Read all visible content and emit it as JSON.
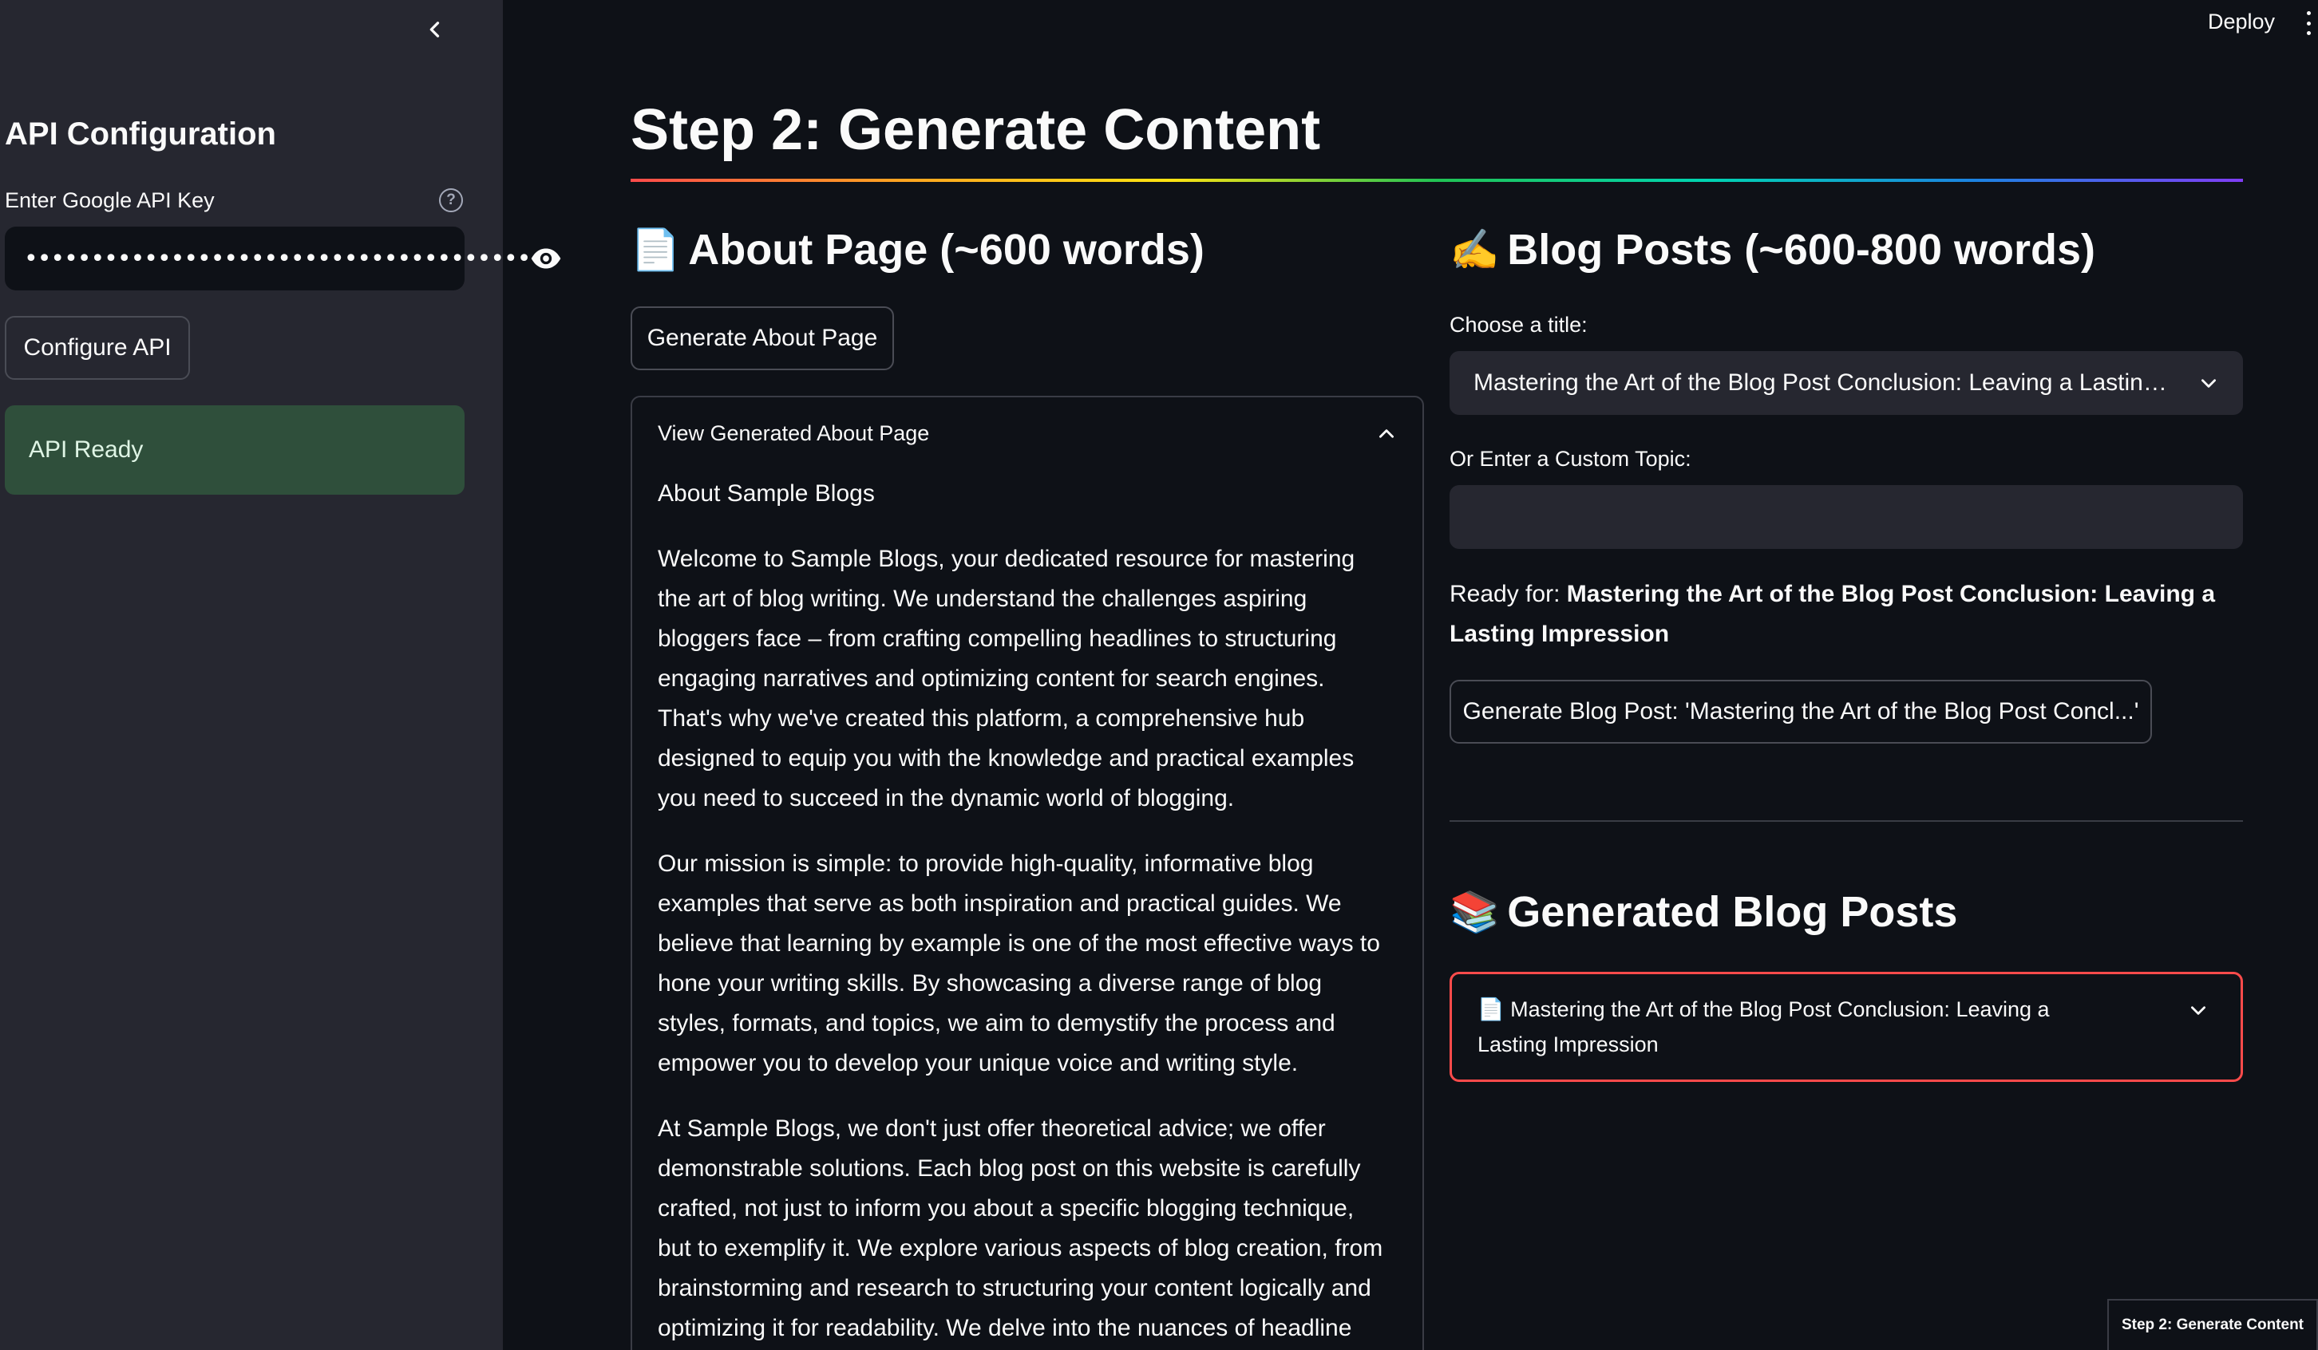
{
  "sidebar": {
    "title": "API Configuration",
    "api_key_label": "Enter Google API Key",
    "api_key_masked": "••••••••••••••••••••••••••••••••••••••",
    "help_glyph": "?",
    "configure_label": "Configure API",
    "status_text": "API Ready",
    "status_color": "#2f4f3b"
  },
  "topbar": {
    "deploy_label": "Deploy"
  },
  "main": {
    "title": "Step 2: Generate Content",
    "about": {
      "emoji": "📄",
      "heading": "About Page (~600 words)",
      "generate_label": "Generate About Page",
      "expander_label": "View Generated About Page",
      "subtitle": "About Sample Blogs",
      "paragraphs": [
        "Welcome to Sample Blogs, your dedicated resource for mastering the art of blog writing. We understand the challenges aspiring bloggers face – from crafting compelling headlines to structuring engaging narratives and optimizing content for search engines. That's why we've created this platform, a comprehensive hub designed to equip you with the knowledge and practical examples you need to succeed in the dynamic world of blogging.",
        "Our mission is simple: to provide high-quality, informative blog examples that serve as both inspiration and practical guides. We believe that learning by example is one of the most effective ways to hone your writing skills. By showcasing a diverse range of blog styles, formats, and topics, we aim to demystify the process and empower you to develop your unique voice and writing style.",
        "At Sample Blogs, we don't just offer theoretical advice; we offer demonstrable solutions. Each blog post on this website is carefully crafted, not just to inform you about a specific blogging technique, but to exemplify it. We explore various aspects of blog creation, from brainstorming and research to structuring your content logically and optimizing it for readability. We delve into the nuances of headline"
      ]
    },
    "blog": {
      "emoji": "✍️",
      "heading": "Blog Posts (~600-800 words)",
      "choose_label": "Choose a title:",
      "selected_title": "Mastering the Art of the Blog Post Conclusion: Leaving a Lasting Impression",
      "custom_label": "Or Enter a Custom Topic:",
      "custom_value": "",
      "ready_prefix": "Ready for: ",
      "ready_title": "Mastering the Art of the Blog Post Conclusion: Leaving a Lasting Impression",
      "generate_label": "Generate Blog Post: 'Mastering the Art of the Blog Post Concl...'"
    },
    "generated": {
      "emoji": "📚",
      "heading": "Generated Blog Posts",
      "item_emoji": "📄",
      "item_title": "Mastering the Art of the Blog Post Conclusion: Leaving a Lasting Impression",
      "accent": "#ff4b4b"
    }
  },
  "toc_tag": "Step 2: Generate Content"
}
